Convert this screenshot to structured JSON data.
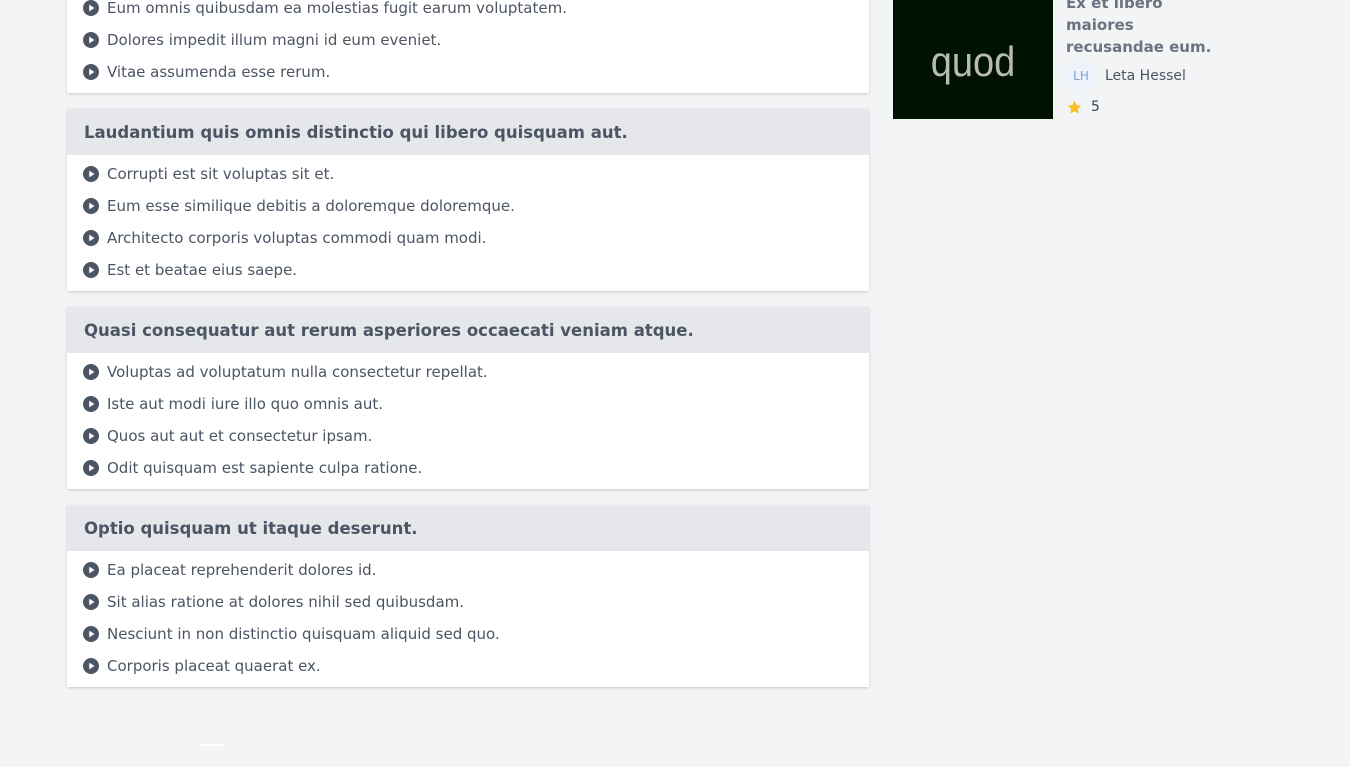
{
  "curriculum": {
    "sections": [
      {
        "title": "",
        "lessons": [
          "Eum omnis quibusdam ea molestias fugit earum voluptatem.",
          "Dolores impedit illum magni id eum eveniet.",
          "Vitae assumenda esse rerum."
        ]
      },
      {
        "title": "Laudantium quis omnis distinctio qui libero quisquam aut.",
        "lessons": [
          "Corrupti est sit voluptas sit et.",
          "Eum esse similique debitis a doloremque doloremque.",
          "Architecto corporis voluptas commodi quam modi.",
          "Est et beatae eius saepe."
        ]
      },
      {
        "title": "Quasi consequatur aut rerum asperiores occaecati veniam atque.",
        "lessons": [
          "Voluptas ad voluptatum nulla consectetur repellat.",
          "Iste aut modi iure illo quo omnis aut.",
          "Quos aut aut et consectetur ipsam.",
          "Odit quisquam est sapiente culpa ratione."
        ]
      },
      {
        "title": "Optio quisquam ut itaque deserunt.",
        "lessons": [
          "Ea placeat reprehenderit dolores id.",
          "Sit alias ratione at dolores nihil sed quibusdam.",
          "Nesciunt in non distinctio quisquam aliquid sed quo.",
          "Corporis placeat quaerat ex."
        ]
      }
    ]
  },
  "related_course": {
    "thumbnail_text": "quod",
    "title": "Ex et libero maiores recusandae eum.",
    "author_initials": "LH",
    "author_name": "Leta Hessel",
    "rating": "5"
  },
  "colors": {
    "page_bg": "#f3f4f6",
    "section_header_bg": "#e5e7eb",
    "icon": "#4b5563",
    "star": "#fbbf24",
    "thumbnail_bg": "#001300"
  },
  "icons": {
    "lesson": "play-circle-icon",
    "rating": "star-icon"
  }
}
